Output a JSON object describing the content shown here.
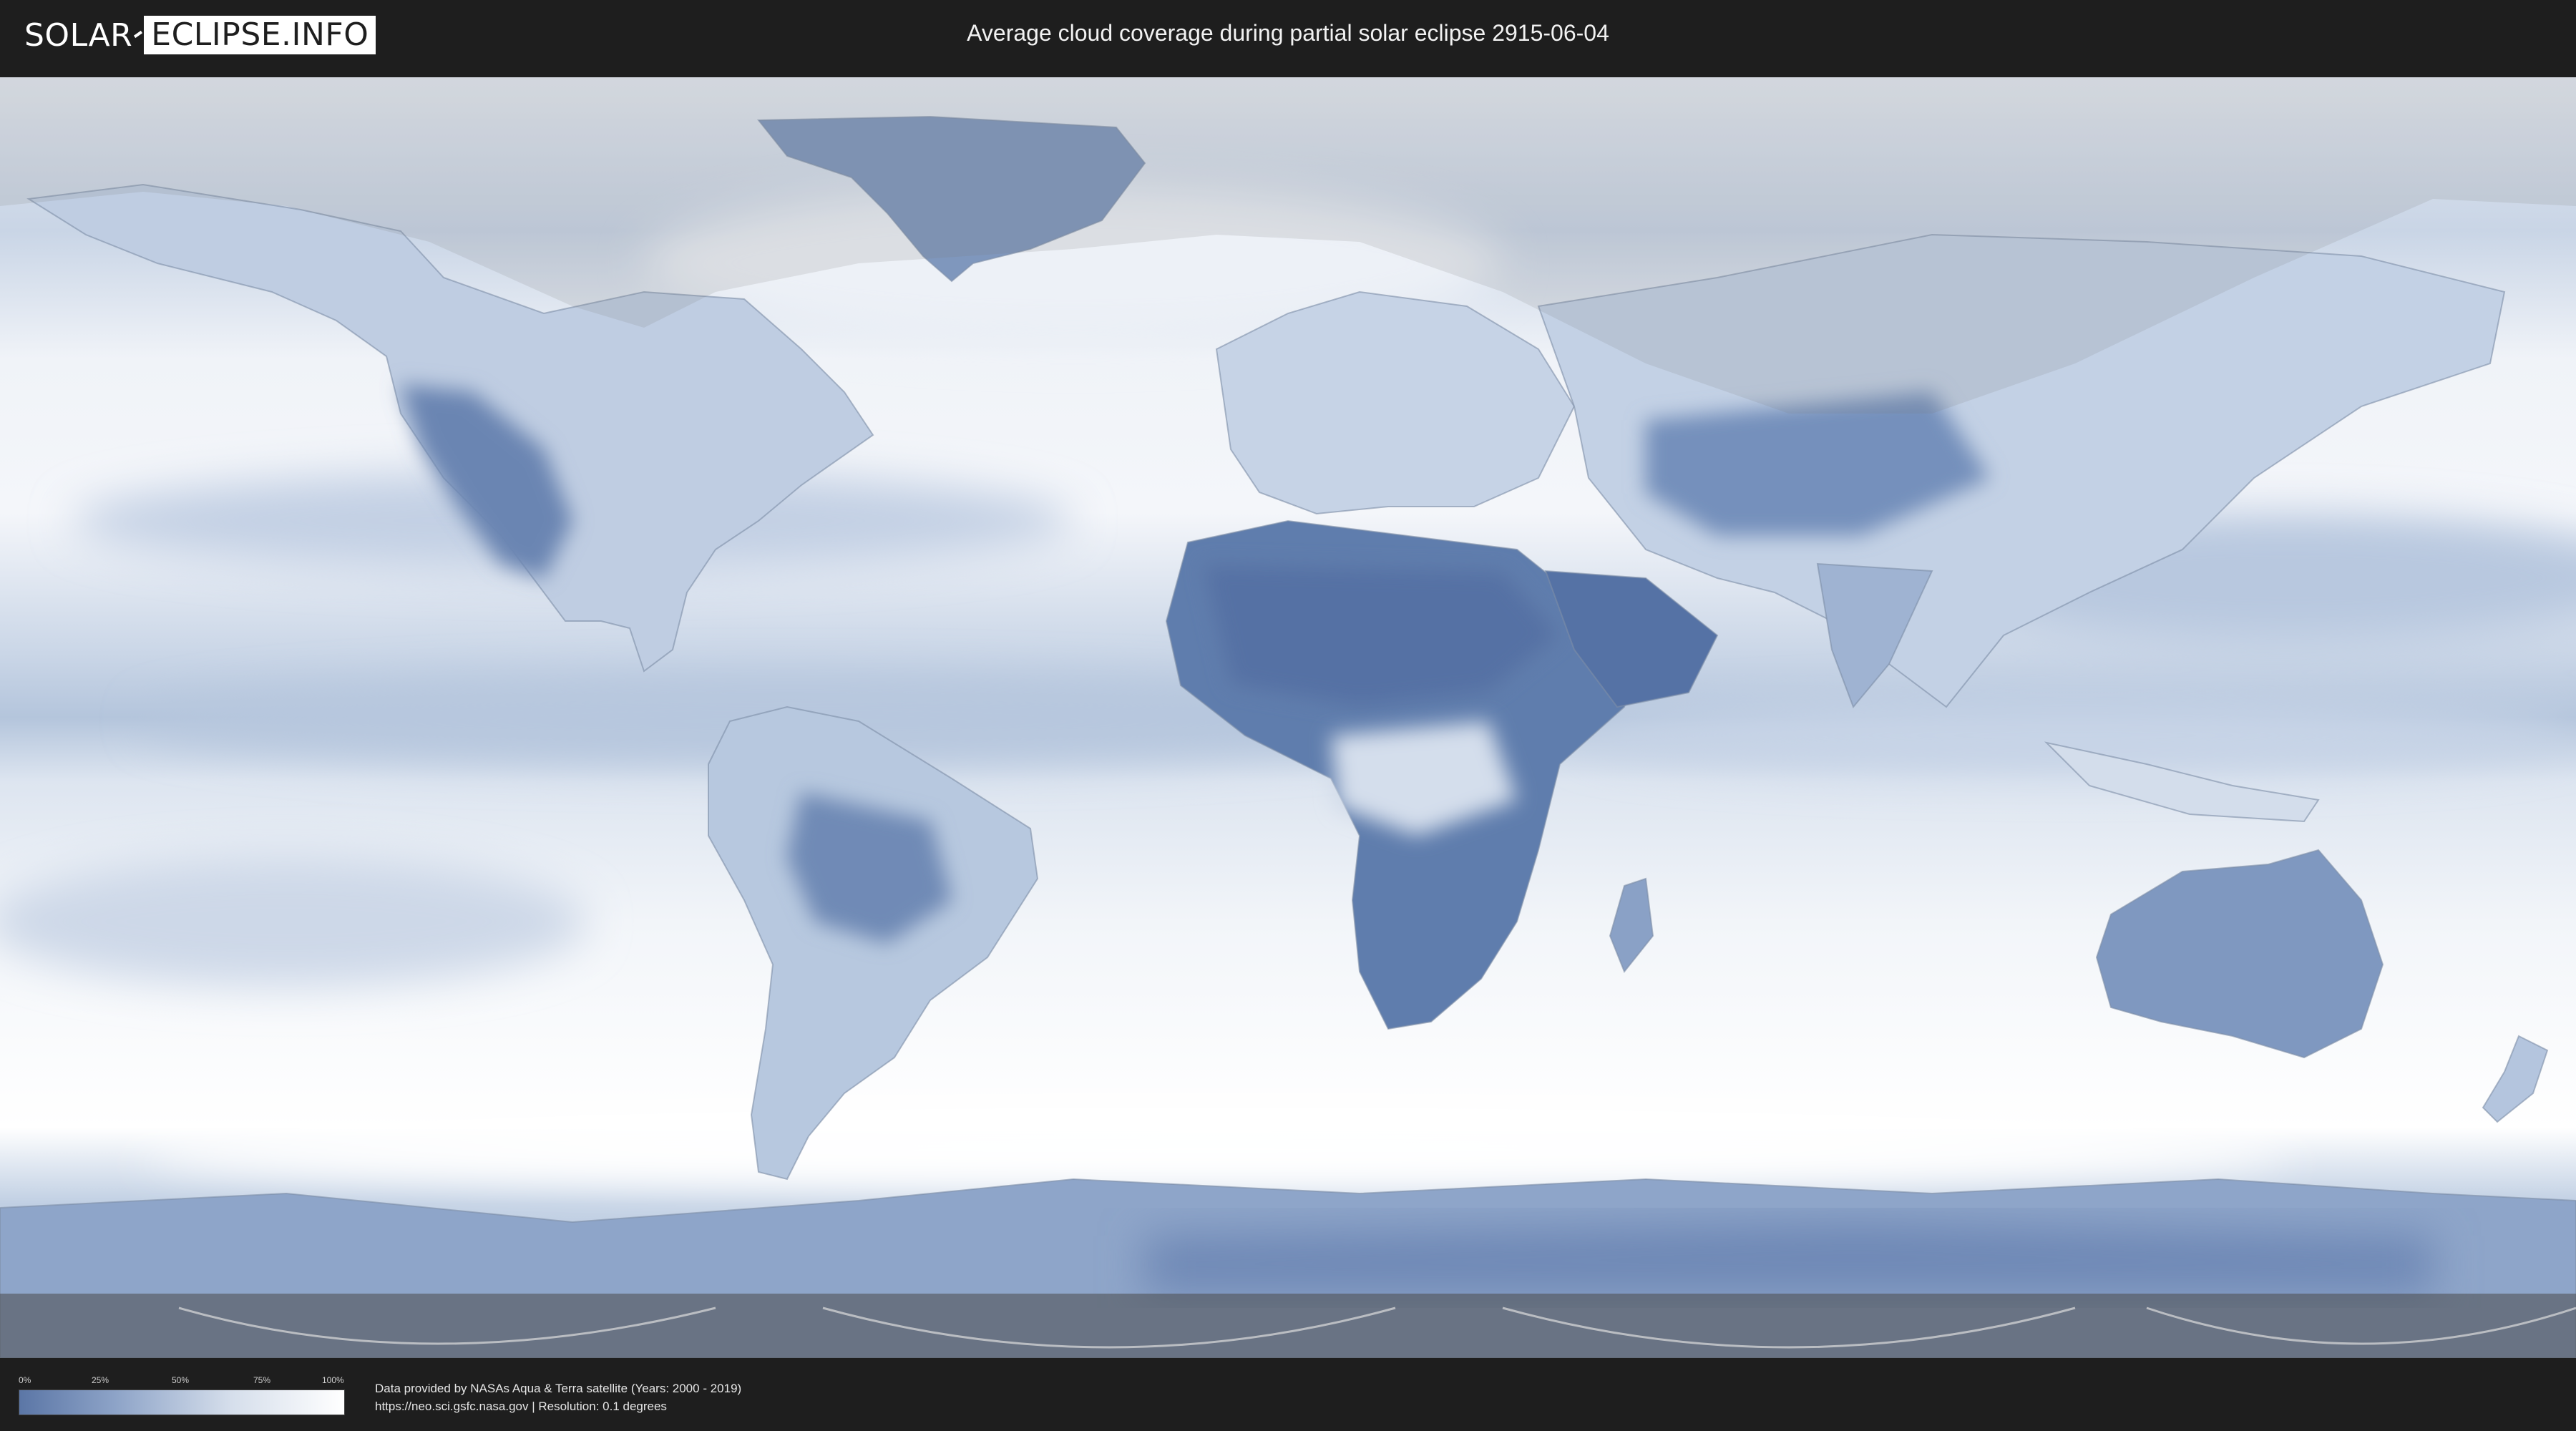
{
  "header": {
    "logo_part1": "SOLAR",
    "logo_part2": "ECLIPSE.INFO",
    "title": "Average cloud coverage during partial solar eclipse 2915-06-04"
  },
  "legend": {
    "ticks": [
      "0%",
      "25%",
      "50%",
      "75%",
      "100%"
    ],
    "gradient_colors": [
      "#5b76a6",
      "#8ea4c8",
      "#d5deeb",
      "#ffffff"
    ]
  },
  "footer": {
    "credit_line1": "Data provided by NASAs Aqua & Terra satellite (Years: 2000 - 2019)",
    "credit_line2": "https://neo.sci.gsfc.nasa.gov | Resolution: 0.1 degrees"
  },
  "map": {
    "type": "world cloud coverage map",
    "colors": {
      "clear": "#ffffff",
      "cloud_light": "#d5deeb",
      "cloud_mid": "#8ea4c8",
      "cloud_dark": "#5b76a6",
      "land_dark": "#4f6b9c",
      "outside_shade": "#7f7f7f"
    }
  }
}
